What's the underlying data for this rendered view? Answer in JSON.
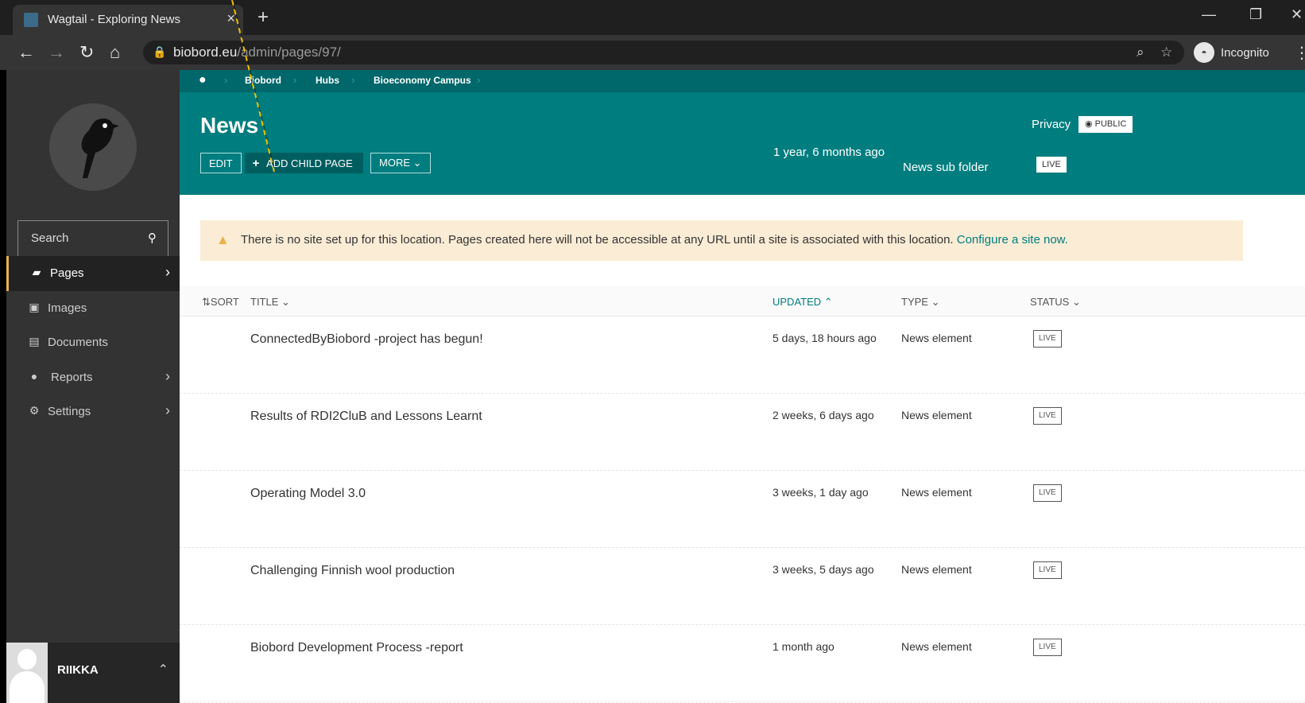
{
  "browser": {
    "tab_title": "Wagtail - Exploring News",
    "tab_close": "×",
    "new_tab": "+",
    "url_host": "biobord.eu",
    "url_path": "/admin/pages/97/",
    "profile": "Incognito",
    "minimize": "—",
    "restore": "❐",
    "close": "✕"
  },
  "sidebar": {
    "search_label": "Search",
    "menu": [
      {
        "label": "Pages",
        "icon": "folder-icon",
        "active": true,
        "has_submenu": true
      },
      {
        "label": "Images",
        "icon": "image-icon",
        "active": false,
        "has_submenu": false
      },
      {
        "label": "Documents",
        "icon": "document-icon",
        "active": false,
        "has_submenu": false
      },
      {
        "label": "Reports",
        "icon": "globe-icon",
        "active": false,
        "has_submenu": true
      },
      {
        "label": "Settings",
        "icon": "cogs-icon",
        "active": false,
        "has_submenu": true
      }
    ],
    "user_name": "RIIKKA"
  },
  "breadcrumb": [
    "Biobord",
    "Hubs",
    "Bioeconomy Campus"
  ],
  "header": {
    "title": "News",
    "edit_label": "EDIT",
    "add_child_label": "ADD CHILD PAGE",
    "more_label": "MORE ⌄",
    "updated": "1 year, 6 months ago",
    "page_type": "News sub folder",
    "status": "LIVE",
    "privacy_label": "Privacy",
    "privacy_value": "PUBLIC"
  },
  "warning": {
    "text": "There is no site set up for this location. Pages created here will not be accessible at any URL until a site is associated with this location. ",
    "link": "Configure a site now."
  },
  "listing": {
    "columns": {
      "sort": "SORT",
      "title": "TITLE ⌄",
      "updated": "UPDATED ⌃",
      "type": "TYPE ⌄",
      "status": "STATUS ⌄"
    },
    "rows": [
      {
        "title": "ConnectedByBiobord -project has begun!",
        "updated": "5 days, 18 hours ago",
        "type": "News element",
        "status": "LIVE"
      },
      {
        "title": "Results of RDI2CluB and Lessons Learnt",
        "updated": "2 weeks, 6 days ago",
        "type": "News element",
        "status": "LIVE"
      },
      {
        "title": "Operating Model 3.0",
        "updated": "3 weeks, 1 day ago",
        "type": "News element",
        "status": "LIVE"
      },
      {
        "title": "Challenging Finnish wool production",
        "updated": "3 weeks, 5 days ago",
        "type": "News element",
        "status": "LIVE"
      },
      {
        "title": "Biobord Development Process -report",
        "updated": "1 month ago",
        "type": "News element",
        "status": "LIVE"
      }
    ]
  },
  "colors": {
    "header_teal": "#007d7e",
    "breadcrumb_teal": "#00676a",
    "sidebar": "#333333",
    "warning_bg": "#faecd5"
  }
}
